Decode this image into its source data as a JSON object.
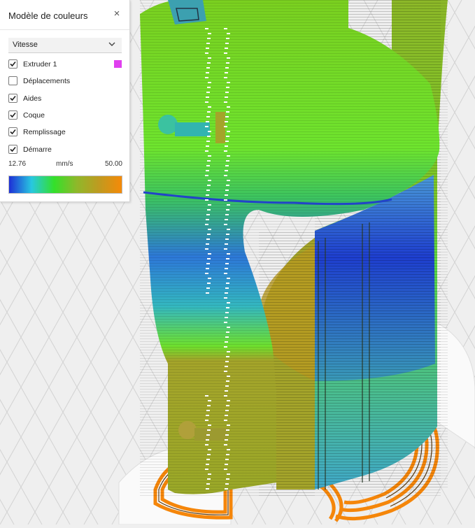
{
  "panel": {
    "title": "Modèle de couleurs",
    "close_glyph": "×",
    "dropdown": {
      "selected": "Vitesse",
      "icon": "chevron-down-icon"
    },
    "items": [
      {
        "label": "Extruder 1",
        "checked": true,
        "swatch": "#e040ef"
      },
      {
        "label": "Déplacements",
        "checked": false
      },
      {
        "label": "Aides",
        "checked": true
      },
      {
        "label": "Coque",
        "checked": true
      },
      {
        "label": "Remplissage",
        "checked": true
      },
      {
        "label": "Démarre",
        "checked": true
      }
    ],
    "range": {
      "min": "12.76",
      "unit": "mm/s",
      "max": "50.00"
    },
    "gradient_colors": [
      "#1e2fd6",
      "#28c8e0",
      "#34e02a",
      "#8fb82a",
      "#c09a20",
      "#f58a08"
    ]
  },
  "colors": {
    "background": "#efefef",
    "grid": "#d2d2d2",
    "skirt": "#f5860a",
    "infill_yellow": "#a4a42a",
    "shell_green": "#6ee02e",
    "slow_blue": "#1e3fd0"
  }
}
